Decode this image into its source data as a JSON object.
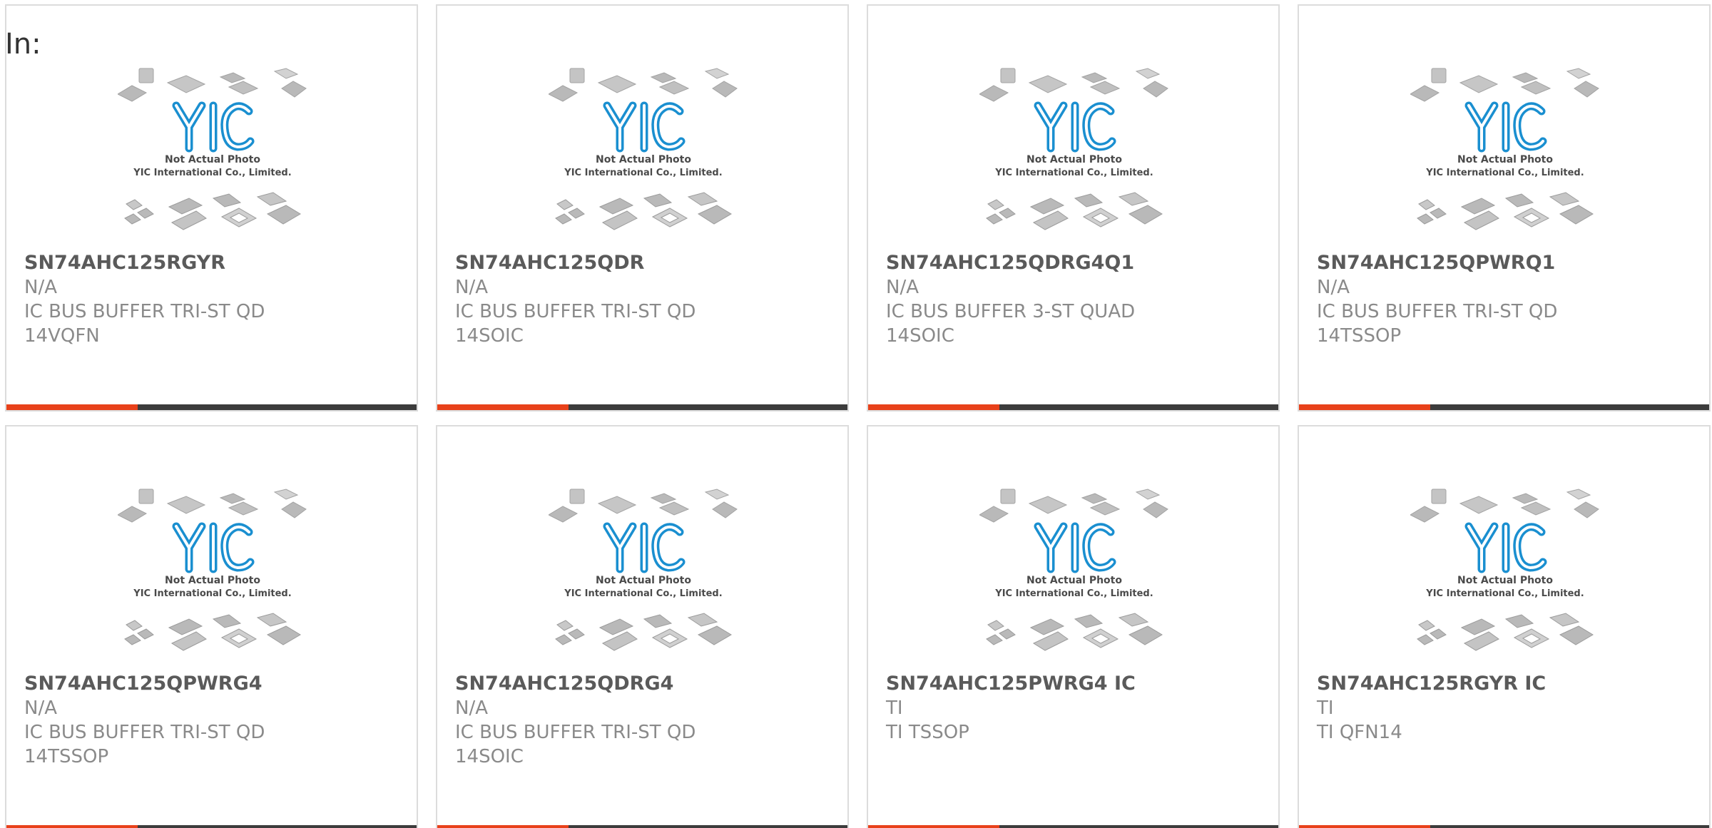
{
  "header": {
    "label": "In:"
  },
  "photo_placeholder": {
    "logo_text": "YIC",
    "caption_line1": "Not Actual Photo",
    "caption_line2": "YIC International Co., Limited."
  },
  "colors": {
    "accent": "#e8411a",
    "bar": "#3c3c3c",
    "logo": "#1a8fd0",
    "title": "#5a5a5a",
    "text": "#8a8a8a"
  },
  "products": [
    {
      "part": "SN74AHC125RGYR",
      "maker": "N/A",
      "desc": "IC BUS BUFFER TRI-ST QD\n14VQFN"
    },
    {
      "part": "SN74AHC125QDR",
      "maker": "N/A",
      "desc": "IC BUS BUFFER TRI-ST QD\n14SOIC"
    },
    {
      "part": "SN74AHC125QDRG4Q1",
      "maker": "N/A",
      "desc": "IC BUS BUFFER 3-ST QUAD\n14SOIC"
    },
    {
      "part": "SN74AHC125QPWRQ1",
      "maker": "N/A",
      "desc": "IC BUS BUFFER TRI-ST QD\n14TSSOP"
    },
    {
      "part": "SN74AHC125QPWRG4",
      "maker": "N/A",
      "desc": "IC BUS BUFFER TRI-ST QD\n14TSSOP"
    },
    {
      "part": "SN74AHC125QDRG4",
      "maker": "N/A",
      "desc": "IC BUS BUFFER TRI-ST QD\n14SOIC"
    },
    {
      "part": "SN74AHC125PWRG4 IC",
      "maker": "TI",
      "desc": "TI TSSOP"
    },
    {
      "part": "SN74AHC125RGYR IC",
      "maker": "TI",
      "desc": "TI QFN14"
    }
  ]
}
